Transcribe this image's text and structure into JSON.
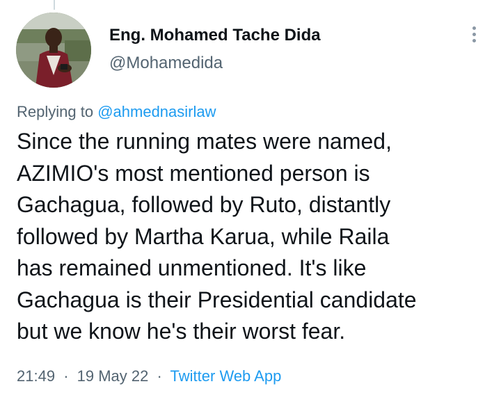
{
  "author": {
    "display_name": "Eng. Mohamed Tache Dida",
    "handle": "@Mohamedida",
    "avatar_icon": "profile-photo"
  },
  "reply": {
    "prefix": "Replying to",
    "mention": "@ahmednasirlaw"
  },
  "tweet": {
    "text": "Since the running mates were named,\nAZIMIO's most mentioned person is\nGachagua, followed by Ruto, distantly\nfollowed by Martha Karua, while Raila\nhas remained unmentioned. It's like\nGachagua is their Presidential candidate\nbut we know he's their worst fear."
  },
  "meta": {
    "time": "21:49",
    "separator": "·",
    "date": "19 May 22",
    "source": "Twitter Web App"
  },
  "colors": {
    "link": "#1d9bf0",
    "secondary_text": "#536471",
    "primary_text": "#0f1419"
  }
}
